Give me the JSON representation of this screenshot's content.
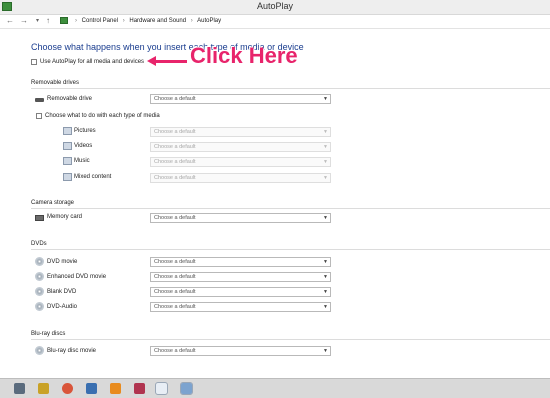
{
  "window": {
    "title": "AutoPlay"
  },
  "address": {
    "back_icon": "back-arrow-icon",
    "forward_icon": "forward-arrow-icon",
    "up_icon": "up-arrow-icon",
    "crumbs": [
      "Control Panel",
      "Hardware and Sound",
      "AutoPlay"
    ],
    "separator": "›"
  },
  "main": {
    "heading": "Choose what happens when you insert each type of media or device",
    "use_autoplay_label": "Use AutoPlay for all media and devices",
    "default_placeholder": "Choose a default",
    "removable": {
      "title": "Removable drives",
      "drive_label": "Removable drive",
      "each_type_label": "Choose what to do with each type of media",
      "media": [
        "Pictures",
        "Videos",
        "Music",
        "Mixed content"
      ]
    },
    "camera": {
      "title": "Camera storage",
      "memory_card": "Memory card"
    },
    "dvds": {
      "title": "DVDs",
      "items": [
        "DVD movie",
        "Enhanced DVD movie",
        "Blank DVD",
        "DVD-Audio"
      ]
    },
    "bluray": {
      "title": "Blu-ray discs",
      "items": [
        "Blu-ray disc movie"
      ]
    }
  },
  "annotation": {
    "text": "Click Here",
    "color": "#e8246b"
  },
  "colors": {
    "heading": "#1a3d8f",
    "window_chrome": "#eeeeee",
    "taskbar": "#d9d9d9"
  },
  "taskbar": {
    "icons": [
      "file-explorer-icon",
      "browser-icon",
      "document-icon",
      "media-player-icon",
      "app-icon",
      "paint-icon",
      "control-panel-icon"
    ]
  }
}
